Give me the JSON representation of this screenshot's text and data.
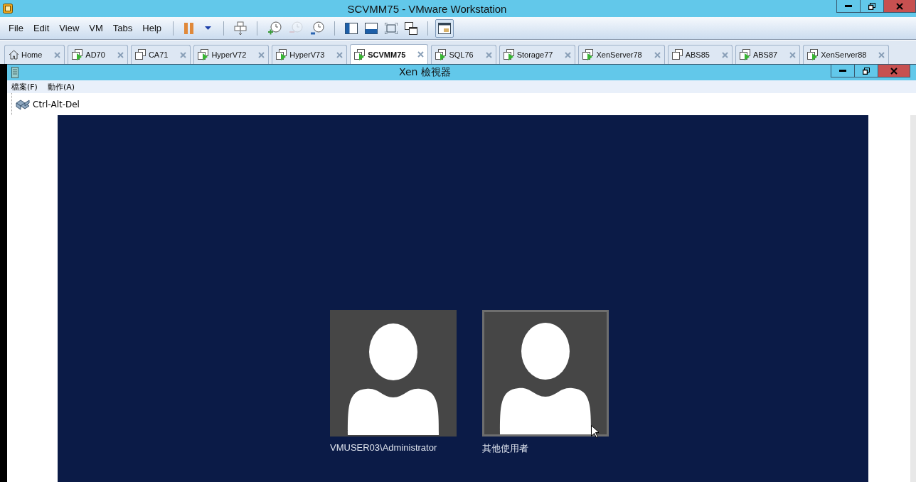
{
  "window": {
    "title": "SCVMM75 - VMware Workstation"
  },
  "menu": [
    "File",
    "Edit",
    "View",
    "VM",
    "Tabs",
    "Help"
  ],
  "toolbar": [
    {
      "kind": "pause",
      "disabled": false,
      "pressed": false
    },
    {
      "kind": "caret",
      "disabled": false,
      "pressed": false
    },
    {
      "kind": "send-keys",
      "disabled": false,
      "pressed": false
    },
    {
      "kind": "snapshot-take",
      "disabled": false,
      "pressed": false
    },
    {
      "kind": "snapshot-revert",
      "disabled": true,
      "pressed": false
    },
    {
      "kind": "snapshot-manage",
      "disabled": false,
      "pressed": false
    },
    {
      "kind": "sidebar",
      "disabled": false,
      "pressed": false
    },
    {
      "kind": "thumbnail",
      "disabled": false,
      "pressed": false
    },
    {
      "kind": "fullscreen",
      "disabled": false,
      "pressed": false
    },
    {
      "kind": "unity",
      "disabled": false,
      "pressed": false
    },
    {
      "kind": "console",
      "disabled": false,
      "pressed": true
    }
  ],
  "tabs": [
    {
      "kind": "home",
      "label": "Home",
      "selected": false
    },
    {
      "kind": "vm",
      "label": "AD70",
      "running": true,
      "selected": false
    },
    {
      "kind": "vm",
      "label": "CA71",
      "running": false,
      "selected": false
    },
    {
      "kind": "vm",
      "label": "HyperV72",
      "running": true,
      "selected": false
    },
    {
      "kind": "vm",
      "label": "HyperV73",
      "running": true,
      "selected": false
    },
    {
      "kind": "vm",
      "label": "SCVMM75",
      "running": true,
      "selected": true
    },
    {
      "kind": "vm",
      "label": "SQL76",
      "running": true,
      "selected": false
    },
    {
      "kind": "vm",
      "label": "Storage77",
      "running": true,
      "selected": false
    },
    {
      "kind": "vm",
      "label": "XenServer78",
      "running": true,
      "selected": false
    },
    {
      "kind": "vm",
      "label": "ABS85",
      "running": false,
      "selected": false
    },
    {
      "kind": "vm",
      "label": "ABS87",
      "running": true,
      "selected": false
    },
    {
      "kind": "vm",
      "label": "XenServer88",
      "running": true,
      "selected": false
    }
  ],
  "viewer": {
    "title": "Xen 檢視器",
    "menu": [
      "檔案(F)",
      "動作(A)"
    ],
    "toolbar_button": "Ctrl-Alt-Del"
  },
  "login": {
    "users": [
      {
        "name": "VMUSER03\\Administrator",
        "selected": false
      },
      {
        "name": "其他使用者",
        "selected": true
      }
    ]
  }
}
